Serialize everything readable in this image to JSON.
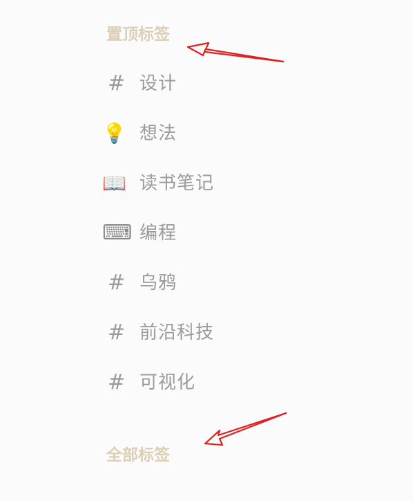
{
  "pinned_section": {
    "title": "置顶标签",
    "items": [
      {
        "icon": "hash-icon",
        "glyph": "#",
        "label": "设计"
      },
      {
        "icon": "lightbulb-icon",
        "glyph": "💡",
        "label": "想法"
      },
      {
        "icon": "book-icon",
        "glyph": "📖",
        "label": "读书笔记"
      },
      {
        "icon": "keyboard-icon",
        "glyph": "⌨",
        "label": "编程"
      },
      {
        "icon": "hash-icon",
        "glyph": "#",
        "label": "乌鸦"
      },
      {
        "icon": "hash-icon",
        "glyph": "#",
        "label": "前沿科技"
      },
      {
        "icon": "hash-icon",
        "glyph": "#",
        "label": "可视化"
      }
    ]
  },
  "all_section": {
    "title": "全部标签"
  },
  "colors": {
    "section_title": "#dccfb6",
    "tag_text": "#9b9b9b",
    "annotation_arrow": "#e0201e",
    "background": "#fbfbfb"
  }
}
